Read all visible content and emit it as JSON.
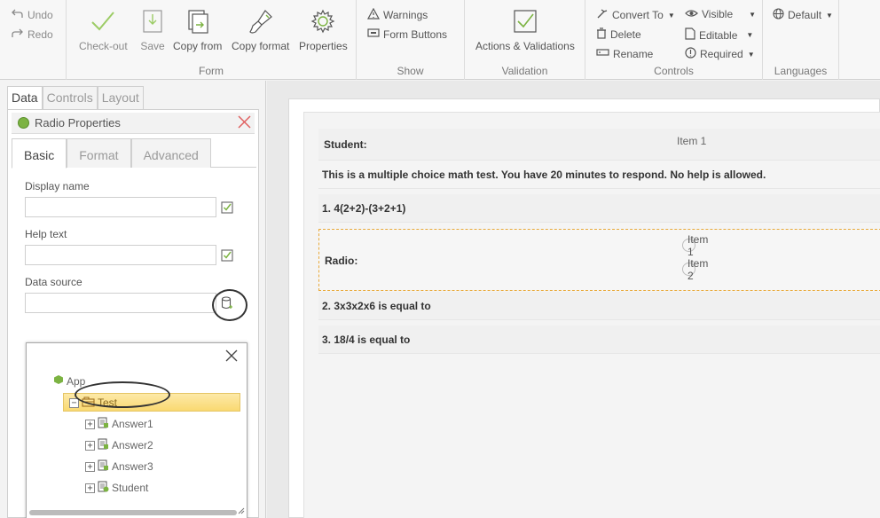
{
  "ribbon": {
    "undo": "Undo",
    "redo": "Redo",
    "form_group": {
      "label": "Form",
      "checkout": "Check-out",
      "save": "Save",
      "copy_from": "Copy from",
      "copy_format": "Copy format",
      "properties": "Properties"
    },
    "show_group": {
      "label": "Show",
      "warnings": "Warnings",
      "form_buttons": "Form Buttons"
    },
    "validation_group": {
      "label": "Validation",
      "actions": "Actions & Validations"
    },
    "controls_group": {
      "label": "Controls",
      "convert_to": "Convert To",
      "delete": "Delete",
      "rename": "Rename",
      "visible": "Visible",
      "editable": "Editable",
      "required": "Required"
    },
    "languages_group": {
      "label": "Languages",
      "default": "Default"
    }
  },
  "left_panel": {
    "tabs": [
      "Data",
      "Controls",
      "Layout"
    ],
    "properties_title": "Radio Properties",
    "subtabs": [
      "Basic",
      "Format",
      "Advanced"
    ],
    "display_name_label": "Display name",
    "help_text_label": "Help text",
    "data_source_label": "Data source",
    "tree": {
      "root": "App",
      "node": "Test",
      "children": [
        "Answer1",
        "Answer2",
        "Answer3",
        "Student"
      ]
    }
  },
  "form": {
    "student_label": "Student:",
    "student_item": "Item 1",
    "intro": "This is a multiple choice math test. You have 20 minutes to respond. No help is allowed.",
    "q1": "1. 4(2+2)-(3+2+1)",
    "radio_label": "Radio:",
    "radio_items": [
      "Item 1",
      "Item 2"
    ],
    "q2": "2. 3x3x2x6 is equal to",
    "q3": "3. 18/4 is equal to"
  },
  "colors": {
    "accent_green": "#7cb342",
    "highlight": "#f9d971",
    "selection_border": "#e8a93a"
  }
}
